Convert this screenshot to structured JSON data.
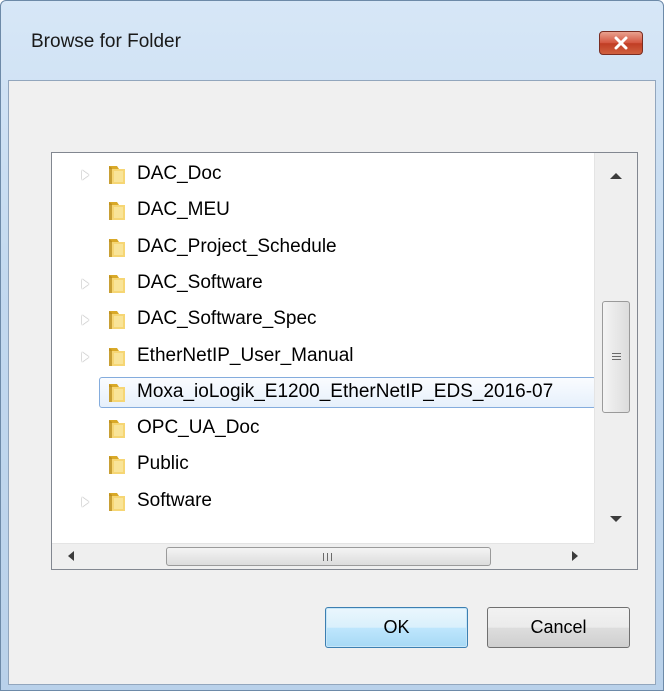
{
  "window": {
    "title": "Browse for Folder",
    "close_icon": "close-icon"
  },
  "tree": {
    "items": [
      {
        "label": "DAC_Doc",
        "expandable": true,
        "selected": false
      },
      {
        "label": "DAC_MEU",
        "expandable": false,
        "selected": false
      },
      {
        "label": "DAC_Project_Schedule",
        "expandable": false,
        "selected": false
      },
      {
        "label": "DAC_Software",
        "expandable": true,
        "selected": false
      },
      {
        "label": "DAC_Software_Spec",
        "expandable": true,
        "selected": false
      },
      {
        "label": "EtherNetIP_User_Manual",
        "expandable": true,
        "selected": false
      },
      {
        "label": "Moxa_ioLogik_E1200_EtherNetIP_EDS_2016-07",
        "expandable": false,
        "selected": true
      },
      {
        "label": "OPC_UA_Doc",
        "expandable": false,
        "selected": false
      },
      {
        "label": "Public",
        "expandable": false,
        "selected": false
      },
      {
        "label": "Software",
        "expandable": true,
        "selected": false
      }
    ]
  },
  "buttons": {
    "ok_label": "OK",
    "cancel_label": "Cancel"
  },
  "colors": {
    "selection_border": "#84acdd",
    "close_button": "#c03d24",
    "folder": "#e8c04a"
  }
}
